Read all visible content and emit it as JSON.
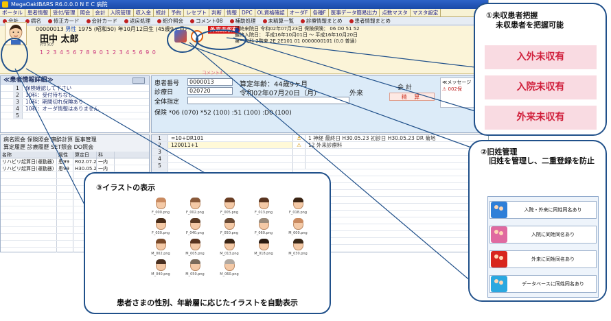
{
  "window": {
    "title": "MegaOakIBARS R6.0.0.0  N E C 病院"
  },
  "menu": [
    "ポータル",
    "患者情報",
    "受付/管理",
    "照会",
    "会計",
    "入院管理",
    "収入金",
    "統計",
    "予約",
    "レセプト",
    "判断",
    "情報",
    "DPC",
    "OL資格確認",
    "オーダF",
    "各種F",
    "医事データ簡易出力",
    "点数マスタ",
    "マスタ設定"
  ],
  "toolbar": [
    "会計",
    "病名",
    "修正カード",
    "会計カード",
    "返戻処理",
    "紹介照会",
    "コメント08",
    "補助処理",
    "未精算一覧",
    "診療情報まとめ",
    "患者情報まとめ"
  ],
  "patient": {
    "id": "00000013",
    "gender": "男性",
    "birth": "1975 (昭和50) 年10月12日生",
    "age": "(45歳9ヶ月)",
    "name": "田中 太郎",
    "kana": "ﾀﾅｶ ﾀﾛｳ",
    "number_strip": "1 2 3 4 5 6 7 8 9 0 1 2 3 4 5 6   9 0",
    "unpaid_tag": "外来未収有",
    "visit_lines": [
      "最終来院日   令和02年07月23日        保険保険：  06 D0 51 52",
      "最終入院日：  平成16年10月01日 ～ 平成16年10月20日",
      "             第一内科 2階東 2E 2E101 01  0000000101 (0.0  普通)"
    ],
    "comment_label": "コメント4"
  },
  "memo": {
    "title": "≪患者情報詳細≫",
    "rows": [
      {
        "n": "1",
        "t": "保険確認して下さい"
      },
      {
        "n": "2",
        "t": "10科：受付待ちなし"
      },
      {
        "n": "3",
        "t": "10科：期間切れ保険あり"
      },
      {
        "n": "4",
        "t": "10科：オーダ情報はありません"
      },
      {
        "n": "5",
        "t": ""
      }
    ]
  },
  "history": {
    "tabs_line1": "病名照会  保険照会  麻酔計算  医事管理",
    "tabs_line2": "算定履歴  診療履歴  SET照会  DO照会",
    "headers": [
      "名称",
      "属性",
      "算定日",
      "科"
    ],
    "rows": [
      {
        "c1": "リハビリ起算日(運動器)",
        "c2": "患99",
        "c3": "R02.07.20",
        "c4": "一内"
      },
      {
        "c1": "リハビリ起算日(運動器)",
        "c2": "患99",
        "c3": "H30.05.23",
        "c4": "一内"
      }
    ]
  },
  "main": {
    "patient_no_label": "患者番号",
    "patient_no": "0000013",
    "date_label": "診療日",
    "date_value": "020720",
    "calc_age": "算定年齢：44歳9ヶ月",
    "calc_date": "令和02年07月20日（月）",
    "visit_type": "外来",
    "full_label": "全体指定",
    "insurance_line": "保険     *06 (070)       *52 (100)       :51 (100)       :D0 (100)",
    "kaikei": "会 計",
    "seisan": "精 算",
    "msg_title": "≪メッセージ",
    "msg_alert": "⚠ 002保"
  },
  "order": {
    "rows": [
      {
        "n": "1",
        "t": "=10+DR101",
        "icn": "⚓",
        "info": "1   神経  最終日 H30.05.23   初診日 H30.05.23  DR  菊地"
      },
      {
        "n": "2",
        "t": "120011+1",
        "icn": "⚠",
        "info": "12  外来診療料"
      },
      {
        "n": "3",
        "t": "",
        "icn": "",
        "info": ""
      },
      {
        "n": "4",
        "t": "",
        "icn": "",
        "info": ""
      },
      {
        "n": "5",
        "t": "",
        "icn": "",
        "info": ""
      }
    ]
  },
  "callout_illust": {
    "heading": "③イラストの表示",
    "caption": "患者さまの性別、年齢層に応じたイラストを自動表示",
    "icons": [
      {
        "label": "F_000.png",
        "hair": "#c98a60"
      },
      {
        "label": "F_002.png",
        "hair": "#8a5a3a"
      },
      {
        "label": "F_005.png",
        "hair": "#6a3e24"
      },
      {
        "label": "F_013.png",
        "hair": "#5a3520"
      },
      {
        "label": "F_018.png",
        "hair": "#3a2414"
      },
      {
        "label": "F_030.png",
        "hair": "#4a2c18"
      },
      {
        "label": "F_040.png",
        "hair": "#5a3a24"
      },
      {
        "label": "F_050.png",
        "hair": "#6a4a34"
      },
      {
        "label": "F_060.png",
        "hair": "#9a8a7a"
      },
      {
        "label": "M_000.png",
        "hair": "#c98a60"
      },
      {
        "label": "M_002.png",
        "hair": "#7a4a2a"
      },
      {
        "label": "M_005.png",
        "hair": "#5a3520"
      },
      {
        "label": "M_013.png",
        "hair": "#3a2414"
      },
      {
        "label": "M_018.png",
        "hair": "#2a1a10"
      },
      {
        "label": "M_030.png",
        "hair": "#3a2818"
      },
      {
        "label": "M_040.png",
        "hair": "#4a3020"
      },
      {
        "label": "M_050.png",
        "hair": "#7a6a5a"
      },
      {
        "label": "M_060.png",
        "hair": "#b0a8a0"
      }
    ]
  },
  "callout_unpaid": {
    "heading": "①未収患者把握",
    "sub": "未収患者を把握可能",
    "items": [
      "入外未収有",
      "入院未収有",
      "外来未収有"
    ]
  },
  "callout_oldname": {
    "heading": "②旧姓管理",
    "desc": "旧姓を管理し、二重登録を防止",
    "items": [
      {
        "text": "入院・外来に同姓同名あり",
        "color": "#2f7fd8"
      },
      {
        "text": "入院に同姓同名あり",
        "color": "#e06aa0"
      },
      {
        "text": "外来に同姓同名あり",
        "color": "#d8261e"
      },
      {
        "text": "データベースに同姓同名あり",
        "color": "#2aa8e0"
      }
    ]
  }
}
